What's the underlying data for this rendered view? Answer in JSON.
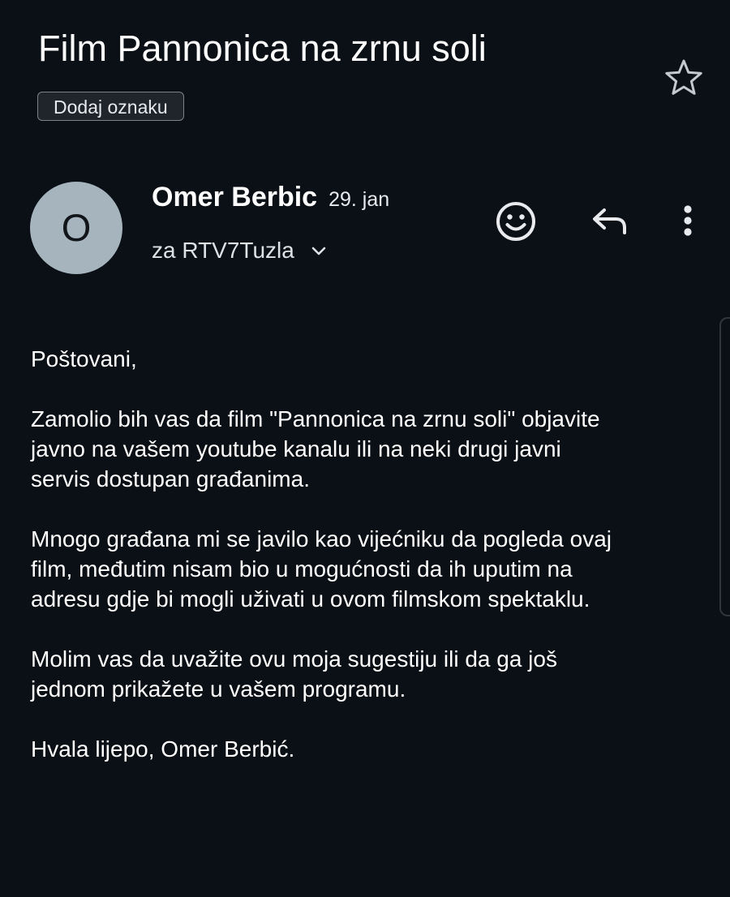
{
  "email": {
    "subject": "Film Pannonica na zrnu soli",
    "label_chip": "Dodaj oznaku",
    "sender": {
      "avatar_letter": "O",
      "name": "Omer Berbic",
      "date": "29. jan",
      "recipient_line": "za RTV7Tuzla"
    },
    "body_paragraphs": [
      "Poštovani,",
      "Zamolio bih vas da film \"Pannonica na zrnu soli\" objavite\njavno na vašem youtube kanalu ili na neki drugi javni\nservis dostupan građanima.",
      "Mnogo građana mi se javilo kao vijećniku da pogleda ovaj\nfilm, međutim nisam bio u mogućnosti da ih uputim na\nadresu gdje bi mogli uživati u ovom filmskom spektaklu.",
      "Molim vas da uvažite ovu moja sugestiju ili da ga još\njednom prikažete u vašem programu.",
      "Hvala lijepo, Omer Berbić."
    ]
  },
  "icons": {
    "star": "star-outline-icon",
    "emoji": "emoji-reaction-icon",
    "reply": "reply-icon",
    "more": "more-vertical-icon",
    "chevron": "chevron-down-icon"
  },
  "colors": {
    "background": "#0b1016",
    "text": "#ffffff",
    "avatar": "#a6b4be",
    "chip_background": "#20252b",
    "chip_border": "#7d8289"
  }
}
